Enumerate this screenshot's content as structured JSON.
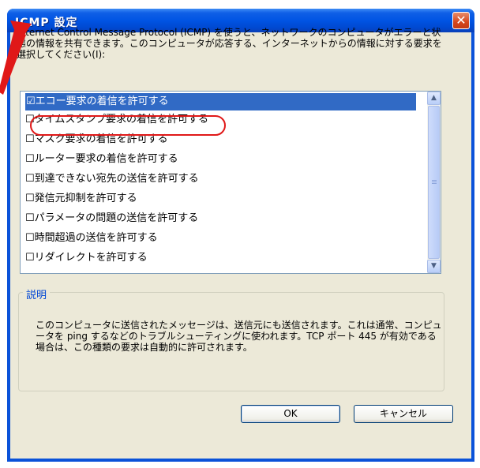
{
  "window": {
    "title": "ICMP 設定",
    "close_symbol": "✕"
  },
  "description": "Internet Control Message Protocol (ICMP) を使うと、ネットワークのコンピュータがエラーと状態の情報を共有できます。このコンピュータが応答する、インターネットからの情報に対する要求を選択してください(I):",
  "list": {
    "items": [
      {
        "label": "☑エコー要求の着信を許可する",
        "checked": true,
        "selected": true
      },
      {
        "label": "☐タイムスタンプ要求の着信を許可する",
        "checked": false,
        "selected": false
      },
      {
        "label": "☐マスク要求の着信を許可する",
        "checked": false,
        "selected": false
      },
      {
        "label": "☐ルーター要求の着信を許可する",
        "checked": false,
        "selected": false
      },
      {
        "label": "☐到達できない宛先の送信を許可する",
        "checked": false,
        "selected": false
      },
      {
        "label": "☐発信元抑制を許可する",
        "checked": false,
        "selected": false
      },
      {
        "label": "☐パラメータの問題の送信を許可する",
        "checked": false,
        "selected": false
      },
      {
        "label": "☐時間超過の送信を許可する",
        "checked": false,
        "selected": false
      },
      {
        "label": "☐リダイレクトを許可する",
        "checked": false,
        "selected": false
      }
    ],
    "scroll_up": "▲",
    "scroll_down": "▼"
  },
  "explanation": {
    "label": "説明",
    "text": "このコンピュータに送信されたメッセージは、送信元にも送信されます。これは通常、コンピュータを ping するなどのトラブルシューティングに使われます。TCP ポート 445 が有効である場合は、この種類の要求は自動的に許可されます。"
  },
  "buttons": {
    "ok": "OK",
    "cancel": "キャンセル"
  },
  "colors": {
    "annotation": "#e01818",
    "selection": "#316ac5",
    "titlebar": "#0054e3"
  }
}
